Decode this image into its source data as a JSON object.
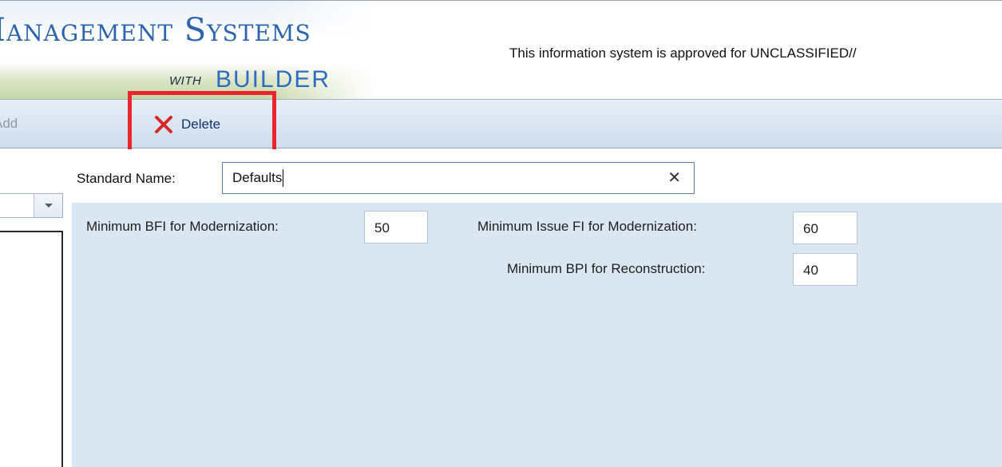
{
  "header": {
    "logo_title": "Management Systems",
    "logo_with": "WITH",
    "logo_builder": "BUILDER",
    "classification_text": "This information system is approved for UNCLASSIFIED//"
  },
  "toolbar": {
    "add_label": "Add",
    "delete_label": "Delete",
    "delete_icon": "red-x-icon"
  },
  "standard": {
    "label": "Standard Name:",
    "value": "Defaults",
    "clear_glyph": "✕"
  },
  "fields": {
    "min_bfi_label": "Minimum BFI for Modernization:",
    "min_bfi_value": "50",
    "min_issue_fi_label": "Minimum Issue FI for Modernization:",
    "min_issue_fi_value": "60",
    "min_bpi_label": "Minimum BPI for Reconstruction:",
    "min_bpi_value": "40"
  },
  "colors": {
    "highlight": "#e8262b",
    "panel_bg": "#dbe6f3",
    "logo_blue": "#2d64ad"
  }
}
